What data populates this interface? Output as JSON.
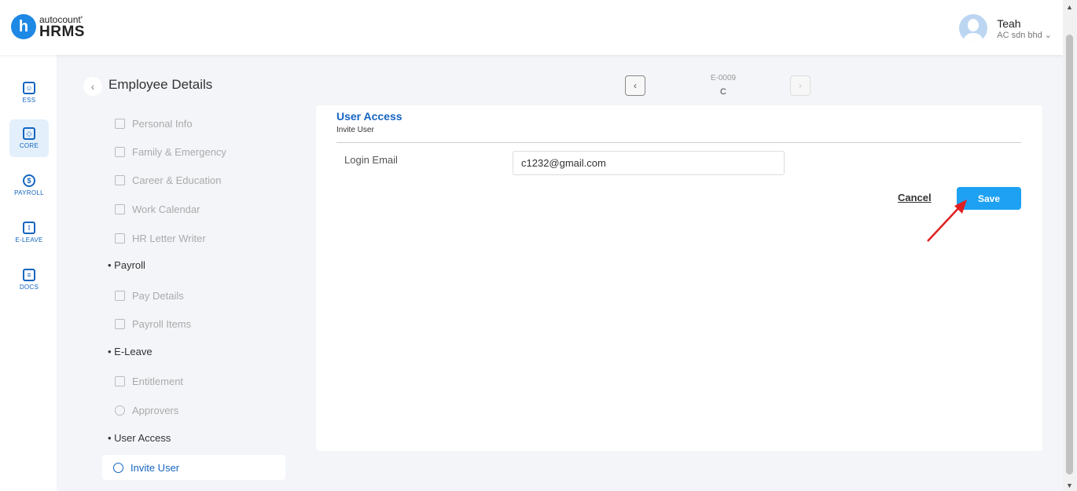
{
  "header": {
    "logo_small": "autocount'",
    "logo_big": "HRMS",
    "logo_letter": "h",
    "user_name": "Teah",
    "user_company": "AC sdn bhd ⌄"
  },
  "nav": [
    {
      "label": "ESS",
      "icon": "ess-icon"
    },
    {
      "label": "CORE",
      "icon": "cube-icon"
    },
    {
      "label": "PAYROLL",
      "icon": "dollar-icon"
    },
    {
      "label": "E-LEAVE",
      "icon": "calendar-icon"
    },
    {
      "label": "DOCS",
      "icon": "document-icon"
    }
  ],
  "page": {
    "title": "Employee Details",
    "employee_code": "E-0009",
    "employee_name": "C"
  },
  "side_menu": {
    "personal_info": "Personal Info",
    "family_emergency": "Family & Emergency",
    "career_education": "Career & Education",
    "work_calendar": "Work Calendar",
    "hr_letter_writer": "HR Letter Writer",
    "section_payroll": "• Payroll",
    "pay_details": "Pay Details",
    "payroll_items": "Payroll Items",
    "section_eleave": "• E-Leave",
    "entitlement": "Entitlement",
    "approvers": "Approvers",
    "section_user_access": "• User Access",
    "invite_user": "Invite User"
  },
  "panel": {
    "title": "User Access",
    "subtitle": "Invite User",
    "login_email_label": "Login Email",
    "login_email_value": "c1232@gmail.com",
    "cancel_label": "Cancel",
    "save_label": "Save"
  },
  "colors": {
    "accent": "#1565c0",
    "save_button": "#1ea1f2",
    "annotation_arrow": "#e02020"
  }
}
